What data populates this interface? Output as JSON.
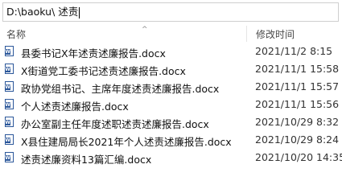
{
  "path_bar": {
    "value": "D:\\baoku\\ 述责"
  },
  "columns": {
    "name": "名称",
    "modified": "修改时间"
  },
  "files": [
    {
      "name": "县委书记X年述责述廉报告.docx",
      "modified": "2021/11/2 8:15"
    },
    {
      "name": "X街道党工委书记述责述廉报告.docx",
      "modified": "2021/11/1 15:58"
    },
    {
      "name": "政协党组书记、主席年度述责述廉报告.docx",
      "modified": "2021/11/1 15:57"
    },
    {
      "name": "个人述责述廉报告.docx",
      "modified": "2021/11/1 15:56"
    },
    {
      "name": "办公室副主任年度述职述责述廉报告.docx",
      "modified": "2021/10/29 8:32"
    },
    {
      "name": "X县住建局局长2021年个人述责述廉报告.docx",
      "modified": "2021/10/29 8:24"
    },
    {
      "name": "述责述廉资料13篇汇编.docx",
      "modified": "2021/10/20 14:35"
    }
  ]
}
